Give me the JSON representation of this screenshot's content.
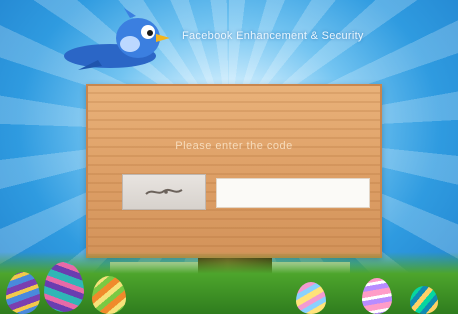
{
  "header": {
    "title": "Facebook Enhancement & Security"
  },
  "sign": {
    "heading": "Please enter the code",
    "captcha_icon": "captcha-image",
    "input_placeholder": ""
  },
  "colors": {
    "sky": "#2f9be0",
    "wood": "#dea067",
    "bird": "#2c6fd4",
    "grass": "#4da52c"
  }
}
